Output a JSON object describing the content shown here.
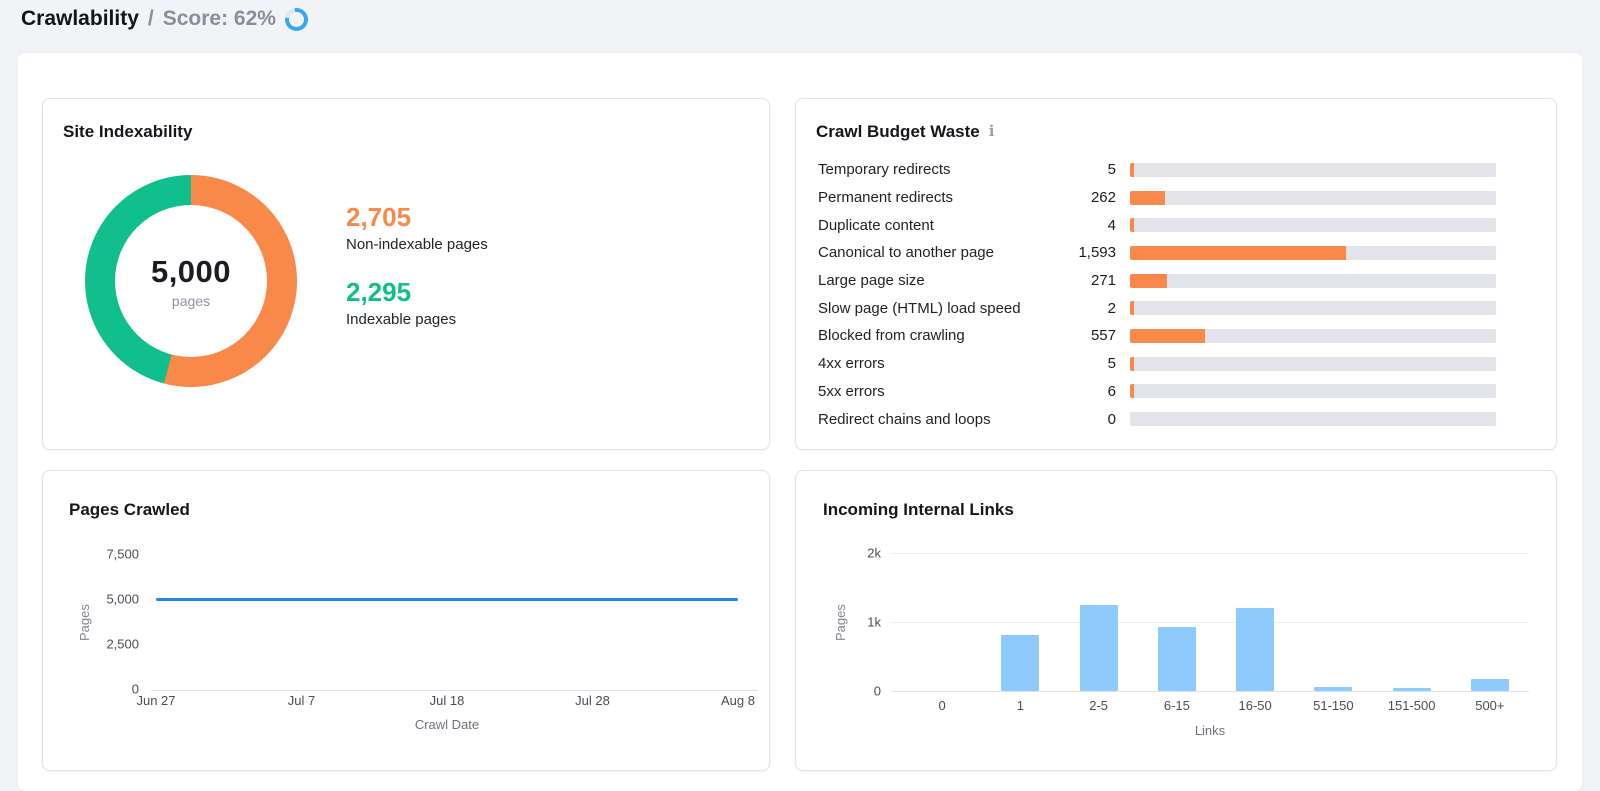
{
  "header": {
    "title": "Crawlability",
    "separator": "/",
    "score": "Score: 62%",
    "score_percent": 62
  },
  "colors": {
    "orange": "#f8894a",
    "green": "#11bf8d",
    "line_blue": "#1f87e8",
    "bar_blue": "#8ecafb",
    "track_gray": "#e3e4e9",
    "spinner_blue": "#38a5f5"
  },
  "panels": {
    "site_indexability": {
      "title": "Site Indexability",
      "donut_center": {
        "total": "5,000",
        "unit": "pages"
      },
      "legend": [
        {
          "value": "2,705",
          "label": "Non-indexable pages",
          "color": "#f8894a"
        },
        {
          "value": "2,295",
          "label": "Indexable pages",
          "color": "#11bf8d"
        }
      ]
    },
    "crawl_budget": {
      "title": "Crawl Budget Waste",
      "info_icon": "i",
      "bar_scale_max": 2705,
      "rows": [
        {
          "label": "Temporary redirects",
          "value": "5",
          "num": 5
        },
        {
          "label": "Permanent redirects",
          "value": "262",
          "num": 262
        },
        {
          "label": "Duplicate content",
          "value": "4",
          "num": 4
        },
        {
          "label": "Canonical to another page",
          "value": "1,593",
          "num": 1593
        },
        {
          "label": "Large page size",
          "value": "271",
          "num": 271
        },
        {
          "label": "Slow page (HTML) load speed",
          "value": "2",
          "num": 2
        },
        {
          "label": "Blocked from crawling",
          "value": "557",
          "num": 557
        },
        {
          "label": "4xx errors",
          "value": "5",
          "num": 5
        },
        {
          "label": "5xx errors",
          "value": "6",
          "num": 6
        },
        {
          "label": "Redirect chains and loops",
          "value": "0",
          "num": 0
        }
      ]
    },
    "pages_crawled": {
      "title": "Pages Crawled",
      "ylabel": "Pages",
      "xlabel": "Crawl Date",
      "yticks": [
        "7,500",
        "5,000",
        "2,500",
        "0"
      ],
      "xticks": [
        "Jun 27",
        "Jul 7",
        "Jul 18",
        "Jul 28",
        "Aug 8"
      ]
    },
    "incoming_links": {
      "title": "Incoming Internal Links",
      "ylabel": "Pages",
      "xlabel": "Links",
      "yticks": [
        "2k",
        "1k",
        "0"
      ],
      "categories": [
        "0",
        "1",
        "2-5",
        "6-15",
        "16-50",
        "51-150",
        "151-500",
        "500+"
      ],
      "values": [
        0,
        810,
        1240,
        930,
        1210,
        55,
        40,
        170
      ]
    }
  },
  "chart_data": [
    {
      "type": "pie",
      "title": "Site Indexability",
      "labels": [
        "Non-indexable pages",
        "Indexable pages"
      ],
      "values": [
        2705,
        2295
      ],
      "colors": [
        "#f8894a",
        "#11bf8d"
      ],
      "center_total": "5,000",
      "center_unit": "pages",
      "donut": true
    },
    {
      "type": "bar",
      "orientation": "horizontal",
      "title": "Crawl Budget Waste",
      "categories": [
        "Temporary redirects",
        "Permanent redirects",
        "Duplicate content",
        "Canonical to another page",
        "Large page size",
        "Slow page (HTML) load speed",
        "Blocked from crawling",
        "4xx errors",
        "5xx errors",
        "Redirect chains and loops"
      ],
      "values": [
        5,
        262,
        4,
        1593,
        271,
        2,
        557,
        5,
        6,
        0
      ],
      "xlim": [
        0,
        2705
      ],
      "grid": false
    },
    {
      "type": "line",
      "title": "Pages Crawled",
      "x": [
        "Jun 27",
        "Jul 7",
        "Jul 18",
        "Jul 28",
        "Aug 8"
      ],
      "series": [
        {
          "name": "Pages",
          "values": [
            5000,
            5000,
            5000,
            5000,
            5000
          ]
        }
      ],
      "xlabel": "Crawl Date",
      "ylabel": "Pages",
      "ylim": [
        0,
        7500
      ],
      "yticks": [
        0,
        2500,
        5000,
        7500
      ],
      "grid": false
    },
    {
      "type": "bar",
      "title": "Incoming Internal Links",
      "categories": [
        "0",
        "1",
        "2-5",
        "6-15",
        "16-50",
        "51-150",
        "151-500",
        "500+"
      ],
      "values": [
        0,
        810,
        1240,
        930,
        1210,
        55,
        40,
        170
      ],
      "xlabel": "Links",
      "ylabel": "Pages",
      "ylim": [
        0,
        2000
      ],
      "yticks": [
        0,
        1000,
        2000
      ],
      "grid": true
    }
  ]
}
